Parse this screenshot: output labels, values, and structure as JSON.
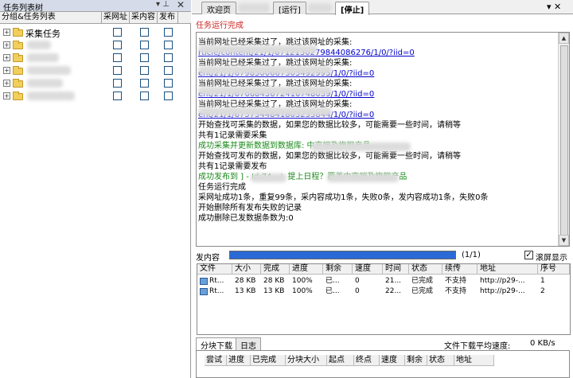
{
  "left_panel": {
    "title": "任务列表树",
    "pin": "⊤ ⊥",
    "close": "✕",
    "headers": [
      "分组&任务列表",
      "采网址",
      "采内容",
      "发布"
    ],
    "root_label": "采集任务"
  },
  "tabs": [
    "欢迎页",
    "[运行]",
    "[停止]"
  ],
  "right_close": "▾ ✕",
  "status": "任务运行完成",
  "log": [
    {
      "t": "当前网址已经采集过了，跳过该网址的采集:",
      "c": ""
    },
    {
      "t": "rticle/content/21/1/6712130279844086276/1/0/?iid=0",
      "c": "link"
    },
    {
      "t": "当前网址已经采集过了，跳过该网址的采集:",
      "c": ""
    },
    {
      "t": "ent/21/1/6798500667305492995/1/0/?iid=0",
      "c": "link"
    },
    {
      "t": "当前网址已经采集过了，跳过该网址的采集:",
      "c": ""
    },
    {
      "t": "ent/21/1/6766843672416748039/1/0/?iid=0",
      "c": "link"
    },
    {
      "t": "当前网址已经采集过了，跳过该网址的采集:",
      "c": ""
    },
    {
      "t": "ent/21/1/6757344841803235844/1/0/?iid=0",
      "c": "link"
    },
    {
      "t": "开始查找可采集的数据，如果您的数据比较多，可能需要一些时间，请稍等",
      "c": ""
    },
    {
      "t": "共有1记录需要采集",
      "c": ""
    },
    {
      "t": "成功采集并更新数据到数据库:                      中高端及旗舰产品",
      "c": "green"
    },
    {
      "t": "开始查找可发布的数据，如果您的数据比较多，可能需要一些时间，请稍等",
      "c": ""
    },
    {
      "t": "共有1记录需要发布",
      "c": ""
    },
    {
      "t": "成功发布到         ] - Id:74 -             ：提上日程？覆盖中高端及旗舰产品",
      "c": "green"
    },
    {
      "t": "任务运行完成",
      "c": ""
    },
    {
      "t": "采网址成功1条，重复99条，采内容成功1条，失败0条，发内容成功1条，失败0条",
      "c": ""
    },
    {
      "t": "开始删除所有发布失败的记录",
      "c": ""
    },
    {
      "t": "成功删除已发数据条数为:0",
      "c": ""
    }
  ],
  "progress": {
    "label": "发内容",
    "count": "(1/1)",
    "fraction": 1.0
  },
  "scroll_display": "滚屏显示",
  "table": {
    "headers": [
      "文件",
      "大小",
      "完成",
      "进度",
      "剩余",
      "速度",
      "时间",
      "状态",
      "续传",
      "地址",
      "序号"
    ],
    "rows": [
      [
        "Rt...",
        "28 KB",
        "28 KB",
        "100%",
        "已...",
        "0",
        "21...",
        "已完成",
        "不支持",
        "http://p29-...",
        "1"
      ],
      [
        "Rt...",
        "13 KB",
        "13 KB",
        "100%",
        "已...",
        "0",
        "22...",
        "已完成",
        "不支持",
        "http://p29-...",
        "2"
      ]
    ]
  },
  "bottom_tabs": [
    "分块下载",
    "日志"
  ],
  "avg_speed_label": "文件下载平均速度:",
  "avg_speed_value": "0 KB/s",
  "block_headers": [
    "尝试",
    "进度",
    "已完成",
    "分块大小",
    "起点",
    "终点",
    "速度",
    "剩余",
    "状态",
    "地址"
  ]
}
